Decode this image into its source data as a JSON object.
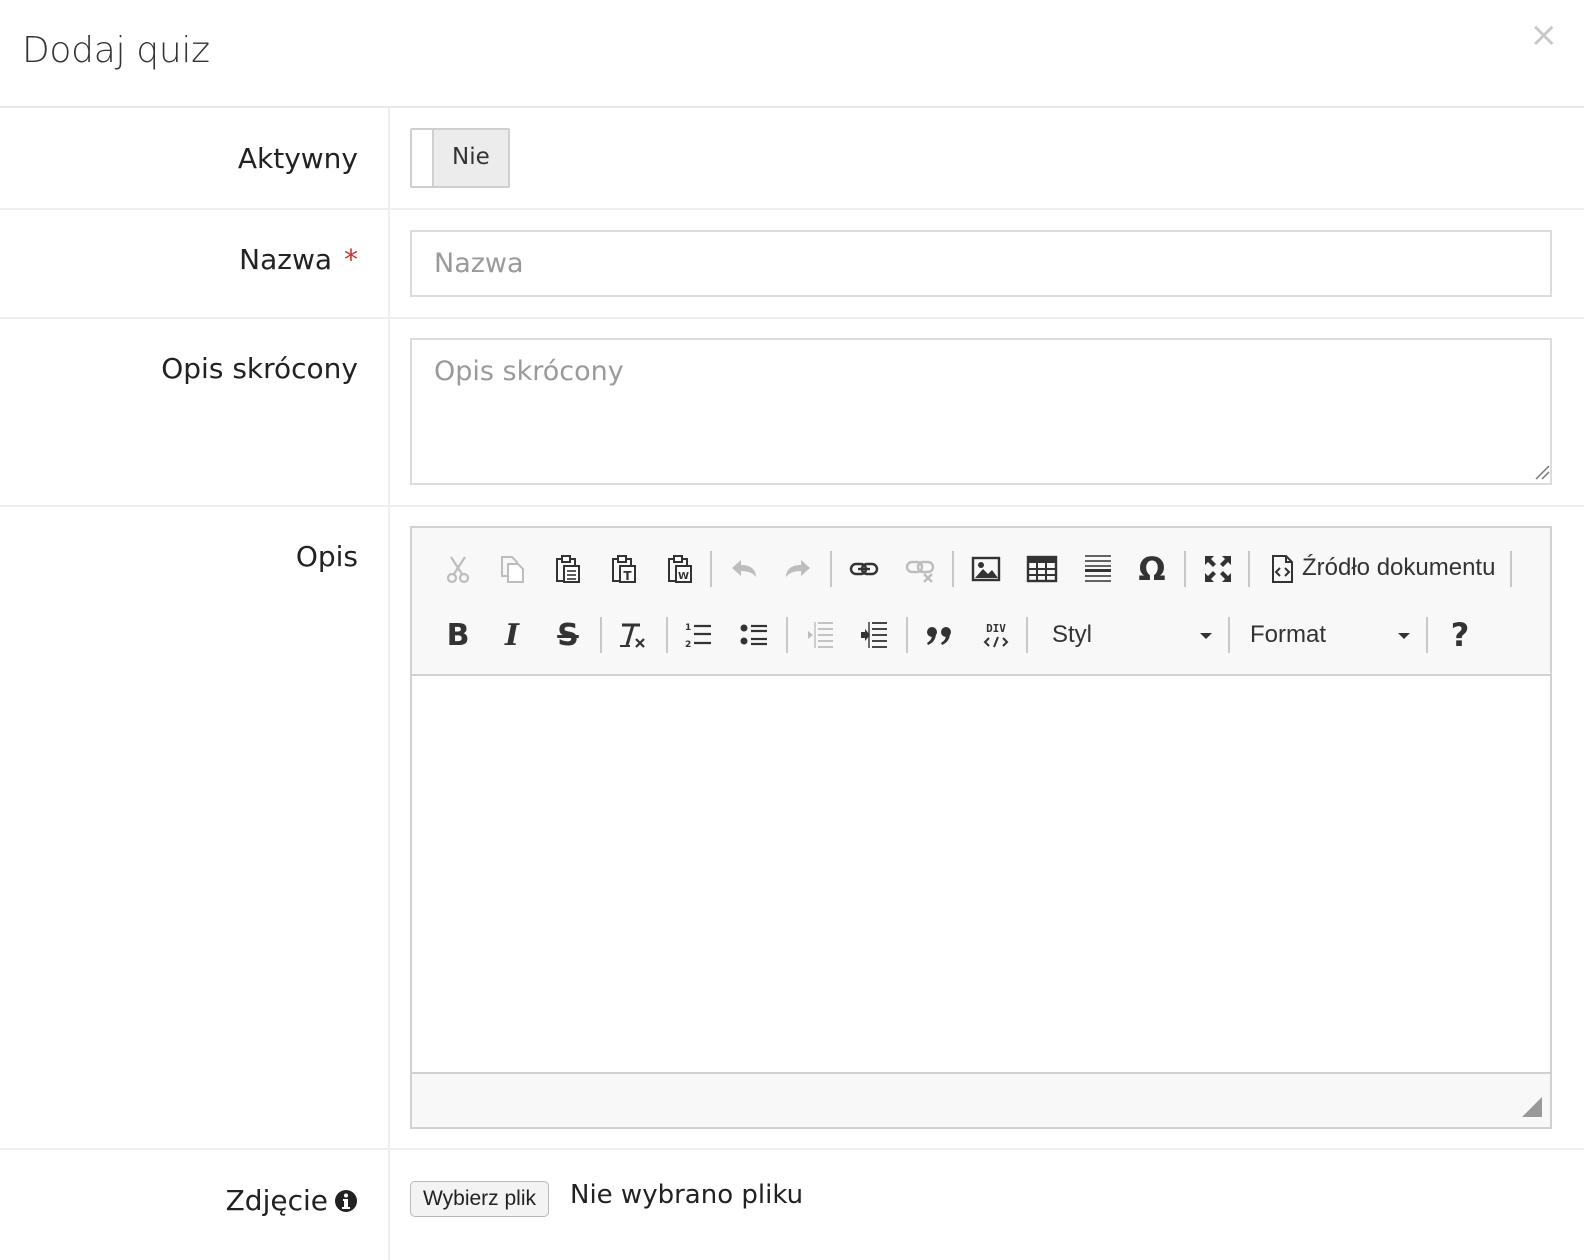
{
  "dialog": {
    "title": "Dodaj quiz",
    "close_label": "×"
  },
  "fields": {
    "active": {
      "label": "Aktywny",
      "toggle_value": "Nie"
    },
    "name": {
      "label": "Nazwa",
      "required_mark": "*",
      "placeholder": "Nazwa",
      "value": ""
    },
    "short_description": {
      "label": "Opis skrócony",
      "placeholder": "Opis skrócony",
      "value": ""
    },
    "description": {
      "label": "Opis"
    },
    "photo": {
      "label": "Zdjęcie",
      "button_label": "Wybierz plik",
      "status": "Nie wybrano pliku"
    }
  },
  "editor": {
    "toolbar_row1": [
      "cut-icon",
      "copy-icon",
      "paste-icon",
      "paste-text-icon",
      "paste-word-icon",
      "undo-icon",
      "redo-icon",
      "link-icon",
      "unlink-icon",
      "image-icon",
      "table-icon",
      "horizontal-rule-icon",
      "special-char-icon",
      "maximize-icon",
      "source-icon"
    ],
    "source_label": "Źródło dokumentu",
    "toolbar_row2": [
      "bold-icon",
      "italic-icon",
      "strike-icon",
      "remove-format-icon",
      "numbered-list-icon",
      "bulleted-list-icon",
      "outdent-icon",
      "indent-icon",
      "blockquote-icon",
      "div-icon",
      "help-icon"
    ],
    "style_combo": "Styl",
    "format_combo": "Format",
    "special_char_glyph": "Ω",
    "help_glyph": "?",
    "div_glyph": "DIV"
  },
  "colors": {
    "required": "#d32f2f",
    "border": "#dcdcdc",
    "toolbar_bg": "#f8f8f8"
  }
}
